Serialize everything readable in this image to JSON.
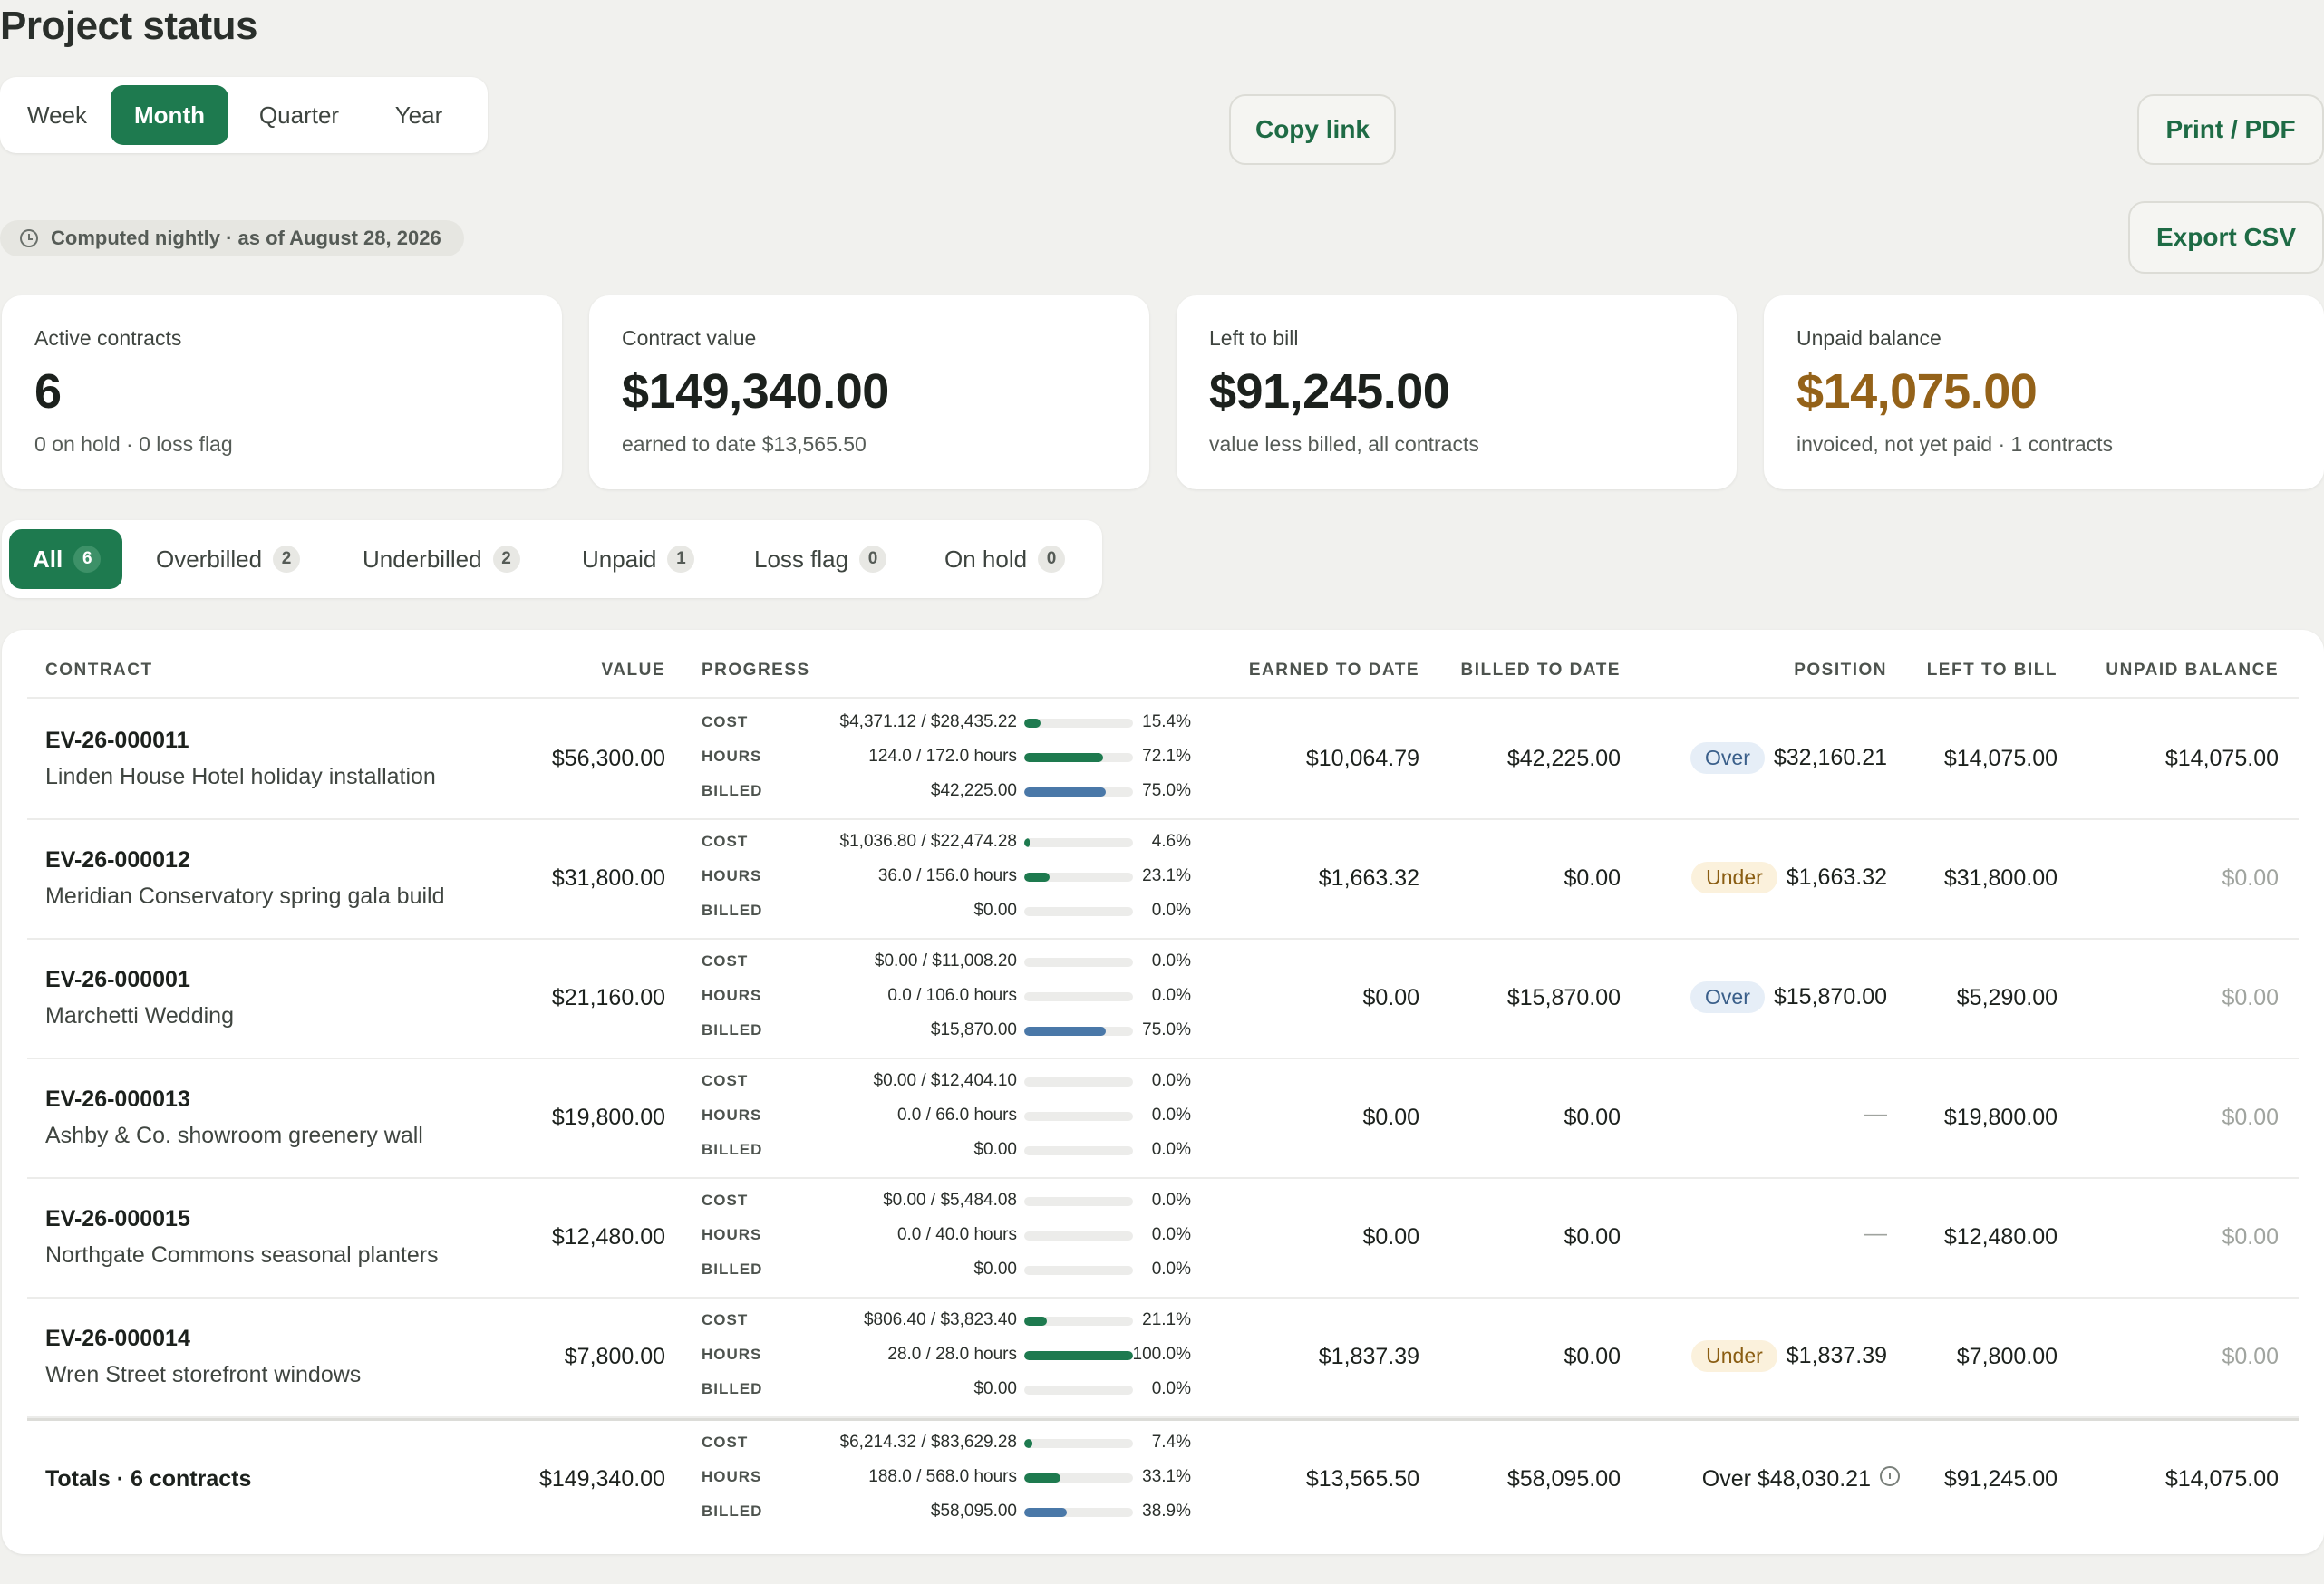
{
  "page": {
    "title": "Project status"
  },
  "periods": {
    "items": [
      "Week",
      "Month",
      "Quarter",
      "Year"
    ],
    "selected": "Month"
  },
  "actions": {
    "copy_link": "Copy link",
    "print_pdf": "Print / PDF",
    "export_csv": "Export CSV"
  },
  "computed_note": "Computed nightly · as of August 28, 2026",
  "kpis": [
    {
      "label": "Active contracts",
      "value": "6",
      "sub": "0 on hold · 0 loss flag"
    },
    {
      "label": "Contract value",
      "value": "$149,340.00",
      "sub": "earned to date $13,565.50"
    },
    {
      "label": "Left to bill",
      "value": "$91,245.00",
      "sub": "value less billed, all contracts"
    },
    {
      "label": "Unpaid balance",
      "value": "$14,075.00",
      "sub": "invoiced, not yet paid · 1 contracts",
      "accent": "#946219"
    }
  ],
  "filters": [
    {
      "label": "All",
      "count": "6",
      "active": true
    },
    {
      "label": "Overbilled",
      "count": "2"
    },
    {
      "label": "Underbilled",
      "count": "2"
    },
    {
      "label": "Unpaid",
      "count": "1"
    },
    {
      "label": "Loss flag",
      "count": "0"
    },
    {
      "label": "On hold",
      "count": "0"
    }
  ],
  "table": {
    "headers": {
      "contract": "CONTRACT",
      "value": "VALUE",
      "progress": "PROGRESS",
      "earned": "EARNED TO DATE",
      "billed": "BILLED TO DATE",
      "position": "POSITION",
      "left": "LEFT TO BILL",
      "unpaid": "UNPAID BALANCE"
    },
    "progress_labels": [
      "COST",
      "HOURS",
      "BILLED"
    ],
    "rows": [
      {
        "id": "EV-26-000011",
        "name": "Linden House Hotel holiday installation",
        "value": "$56,300.00",
        "progress": [
          {
            "text": "$4,371.12 / $28,435.22",
            "pct": "15.4%",
            "fraction": 0.154
          },
          {
            "text": "124.0 / 172.0 hours",
            "pct": "72.1%",
            "fraction": 0.721
          },
          {
            "text": "$42,225.00",
            "pct": "75.0%",
            "fraction": 0.75
          }
        ],
        "earned": "$10,064.79",
        "billed": "$42,225.00",
        "position_tag": "Over",
        "position_value": "$32,160.21",
        "left": "$14,075.00",
        "unpaid": "$14,075.00",
        "unpaid_muted": false
      },
      {
        "id": "EV-26-000012",
        "name": "Meridian Conservatory spring gala build",
        "value": "$31,800.00",
        "progress": [
          {
            "text": "$1,036.80 / $22,474.28",
            "pct": "4.6%",
            "fraction": 0.046
          },
          {
            "text": "36.0 / 156.0 hours",
            "pct": "23.1%",
            "fraction": 0.231
          },
          {
            "text": "$0.00",
            "pct": "0.0%",
            "fraction": 0
          }
        ],
        "earned": "$1,663.32",
        "billed": "$0.00",
        "position_tag": "Under",
        "position_value": "$1,663.32",
        "left": "$31,800.00",
        "unpaid": "$0.00",
        "unpaid_muted": true
      },
      {
        "id": "EV-26-000001",
        "name": "Marchetti Wedding",
        "value": "$21,160.00",
        "progress": [
          {
            "text": "$0.00 / $11,008.20",
            "pct": "0.0%",
            "fraction": 0
          },
          {
            "text": "0.0 / 106.0 hours",
            "pct": "0.0%",
            "fraction": 0
          },
          {
            "text": "$15,870.00",
            "pct": "75.0%",
            "fraction": 0.75
          }
        ],
        "earned": "$0.00",
        "billed": "$15,870.00",
        "position_tag": "Over",
        "position_value": "$15,870.00",
        "left": "$5,290.00",
        "unpaid": "$0.00",
        "unpaid_muted": true
      },
      {
        "id": "EV-26-000013",
        "name": "Ashby & Co. showroom greenery wall",
        "value": "$19,800.00",
        "progress": [
          {
            "text": "$0.00 / $12,404.10",
            "pct": "0.0%",
            "fraction": 0
          },
          {
            "text": "0.0 / 66.0 hours",
            "pct": "0.0%",
            "fraction": 0
          },
          {
            "text": "$0.00",
            "pct": "0.0%",
            "fraction": 0
          }
        ],
        "earned": "$0.00",
        "billed": "$0.00",
        "position_tag": "",
        "position_value": "—",
        "left": "$19,800.00",
        "unpaid": "$0.00",
        "unpaid_muted": true
      },
      {
        "id": "EV-26-000015",
        "name": "Northgate Commons seasonal planters",
        "value": "$12,480.00",
        "progress": [
          {
            "text": "$0.00 / $5,484.08",
            "pct": "0.0%",
            "fraction": 0
          },
          {
            "text": "0.0 / 40.0 hours",
            "pct": "0.0%",
            "fraction": 0
          },
          {
            "text": "$0.00",
            "pct": "0.0%",
            "fraction": 0
          }
        ],
        "earned": "$0.00",
        "billed": "$0.00",
        "position_tag": "",
        "position_value": "—",
        "left": "$12,480.00",
        "unpaid": "$0.00",
        "unpaid_muted": true
      },
      {
        "id": "EV-26-000014",
        "name": "Wren Street storefront windows",
        "value": "$7,800.00",
        "progress": [
          {
            "text": "$806.40 / $3,823.40",
            "pct": "21.1%",
            "fraction": 0.211
          },
          {
            "text": "28.0 / 28.0 hours",
            "pct": "100.0%",
            "fraction": 1.0
          },
          {
            "text": "$0.00",
            "pct": "0.0%",
            "fraction": 0
          }
        ],
        "earned": "$1,837.39",
        "billed": "$0.00",
        "position_tag": "Under",
        "position_value": "$1,837.39",
        "left": "$7,800.00",
        "unpaid": "$0.00",
        "unpaid_muted": true
      }
    ],
    "totals": {
      "label": "Totals · 6 contracts",
      "value": "$149,340.00",
      "progress": [
        {
          "text": "$6,214.32 / $83,629.28",
          "pct": "7.4%",
          "fraction": 0.074
        },
        {
          "text": "188.0 / 568.0 hours",
          "pct": "33.1%",
          "fraction": 0.331
        },
        {
          "text": "$58,095.00",
          "pct": "38.9%",
          "fraction": 0.389
        }
      ],
      "earned": "$13,565.50",
      "billed": "$58,095.00",
      "position": "Over $48,030.21",
      "left": "$91,245.00",
      "unpaid": "$14,075.00"
    }
  },
  "colors": {
    "primary": "#1e7a4f",
    "bar_cost_hours": "#1e7a4f",
    "bar_billed": "#4a78a8",
    "warn": "#946219",
    "over_text": "#3a5f8a",
    "under_text": "#8a5d12"
  }
}
